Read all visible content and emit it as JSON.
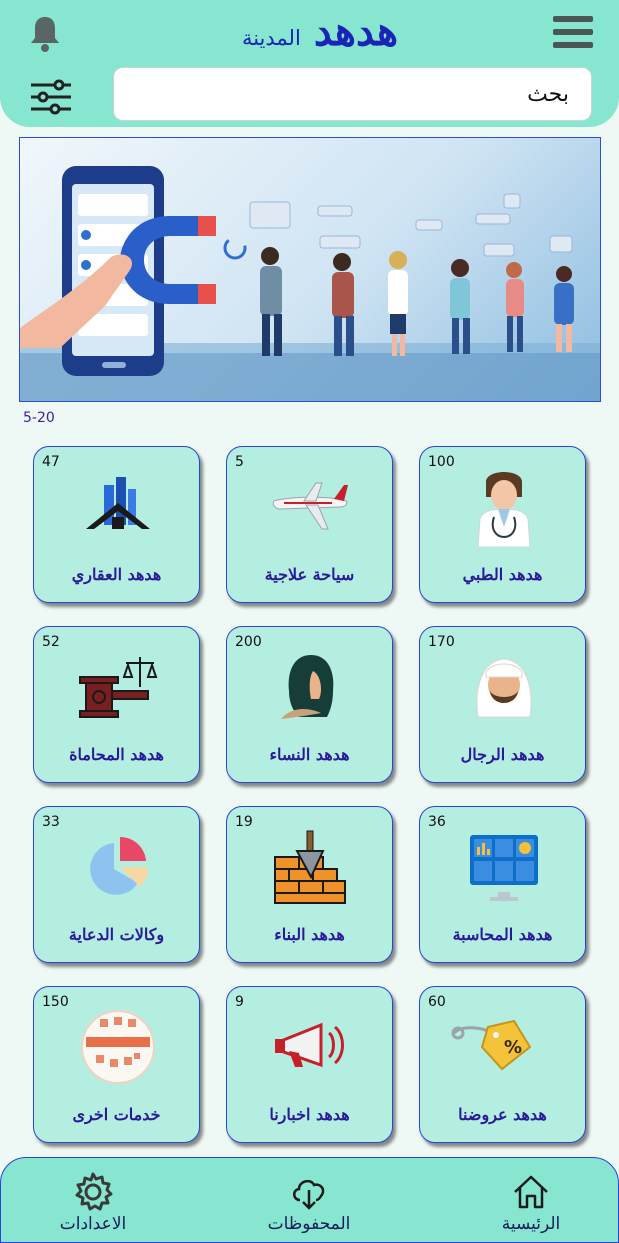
{
  "header": {
    "title": "هدهد",
    "subtitle": "المدينة",
    "search_placeholder": "بحث"
  },
  "banner": {
    "range": "5-20"
  },
  "categories": [
    {
      "label": "هدهد الطبي",
      "count": "100",
      "icon": "doctor-icon"
    },
    {
      "label": "سياحة علاجية",
      "count": "5",
      "icon": "airplane-icon"
    },
    {
      "label": "هدهد العقاري",
      "count": "47",
      "icon": "real-estate-icon"
    },
    {
      "label": "هدهد الرجال",
      "count": "170",
      "icon": "man-icon"
    },
    {
      "label": "هدهد النساء",
      "count": "200",
      "icon": "woman-icon"
    },
    {
      "label": "هدهد المحاماة",
      "count": "52",
      "icon": "law-icon"
    },
    {
      "label": "هدهد المحاسبة",
      "count": "36",
      "icon": "accounting-icon"
    },
    {
      "label": "هدهد البناء",
      "count": "19",
      "icon": "construction-icon"
    },
    {
      "label": "وكالات الدعاية",
      "count": "33",
      "icon": "pie-chart-icon"
    },
    {
      "label": "هدهد عروضنا",
      "count": "60",
      "icon": "discount-tag-icon"
    },
    {
      "label": "هدهد اخبارنا",
      "count": "9",
      "icon": "megaphone-icon"
    },
    {
      "label": "خدمات اخرى",
      "count": "150",
      "icon": "services-icon"
    }
  ],
  "nav": {
    "home": "الرئيسية",
    "saved": "المحفوظات",
    "settings": "الاعدادات"
  },
  "colors": {
    "header_bg": "#86e6cf",
    "card_bg": "#b4eee0",
    "accent": "#1a24b5"
  }
}
